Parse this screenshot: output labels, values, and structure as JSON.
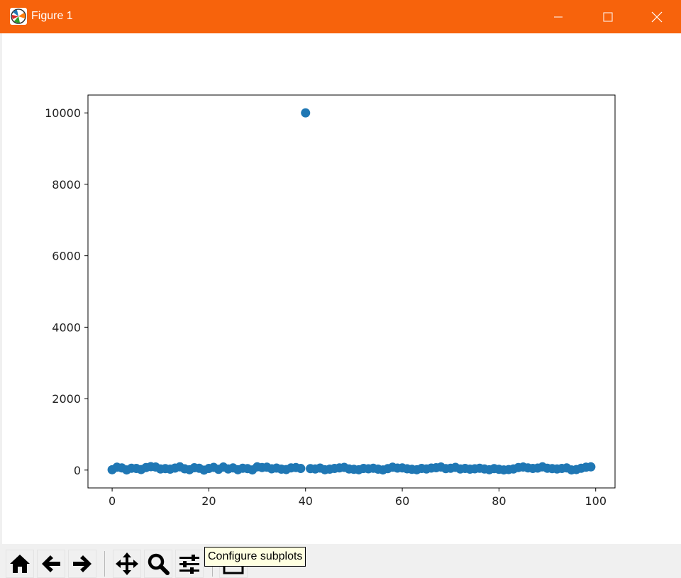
{
  "window": {
    "title": "Figure 1"
  },
  "toolbar": {
    "buttons": [
      {
        "name": "home-button",
        "icon": "home-icon"
      },
      {
        "name": "back-button",
        "icon": "arrow-left-icon"
      },
      {
        "name": "forward-button",
        "icon": "arrow-right-icon"
      },
      {
        "name": "pan-button",
        "icon": "move-arrows-icon"
      },
      {
        "name": "zoom-button",
        "icon": "magnifier-icon"
      },
      {
        "name": "configure-subplots-button",
        "icon": "sliders-icon"
      },
      {
        "name": "save-button",
        "icon": "floppy-disk-icon"
      }
    ],
    "tooltip": "Configure subplots"
  },
  "colors": {
    "titlebar": "#f7630c",
    "marker": "#1f77b4",
    "toolbar": "#f0f0f0"
  },
  "chart_data": {
    "type": "scatter",
    "title": "",
    "xlabel": "",
    "ylabel": "",
    "xlim": [
      -5,
      104
    ],
    "ylim": [
      -500,
      10500
    ],
    "xticks": [
      0,
      20,
      40,
      60,
      80,
      100
    ],
    "yticks": [
      0,
      2000,
      4000,
      6000,
      8000,
      10000
    ],
    "grid": false,
    "x": [
      0,
      1,
      2,
      3,
      4,
      5,
      6,
      7,
      8,
      9,
      10,
      11,
      12,
      13,
      14,
      15,
      16,
      17,
      18,
      19,
      20,
      21,
      22,
      23,
      24,
      25,
      26,
      27,
      28,
      29,
      30,
      31,
      32,
      33,
      34,
      35,
      36,
      37,
      38,
      39,
      40,
      41,
      42,
      43,
      44,
      45,
      46,
      47,
      48,
      49,
      50,
      51,
      52,
      53,
      54,
      55,
      56,
      57,
      58,
      59,
      60,
      61,
      62,
      63,
      64,
      65,
      66,
      67,
      68,
      69,
      70,
      71,
      72,
      73,
      74,
      75,
      76,
      77,
      78,
      79,
      80,
      81,
      82,
      83,
      84,
      85,
      86,
      87,
      88,
      89,
      90,
      91,
      92,
      93,
      94,
      95,
      96,
      97,
      98,
      99
    ],
    "y": [
      10,
      80,
      60,
      5,
      50,
      45,
      15,
      70,
      95,
      85,
      30,
      40,
      25,
      55,
      90,
      35,
      10,
      65,
      50,
      0,
      45,
      75,
      20,
      85,
      30,
      60,
      10,
      50,
      40,
      5,
      90,
      70,
      80,
      35,
      55,
      25,
      15,
      60,
      70,
      45,
      10000,
      40,
      30,
      55,
      10,
      25,
      45,
      60,
      75,
      30,
      20,
      10,
      45,
      35,
      50,
      25,
      5,
      40,
      80,
      55,
      60,
      35,
      20,
      10,
      45,
      30,
      55,
      65,
      85,
      40,
      50,
      75,
      30,
      45,
      25,
      35,
      50,
      30,
      10,
      40,
      20,
      5,
      15,
      30,
      70,
      85,
      60,
      45,
      55,
      90,
      50,
      40,
      30,
      45,
      60,
      5,
      15,
      50,
      80,
      90
    ]
  }
}
